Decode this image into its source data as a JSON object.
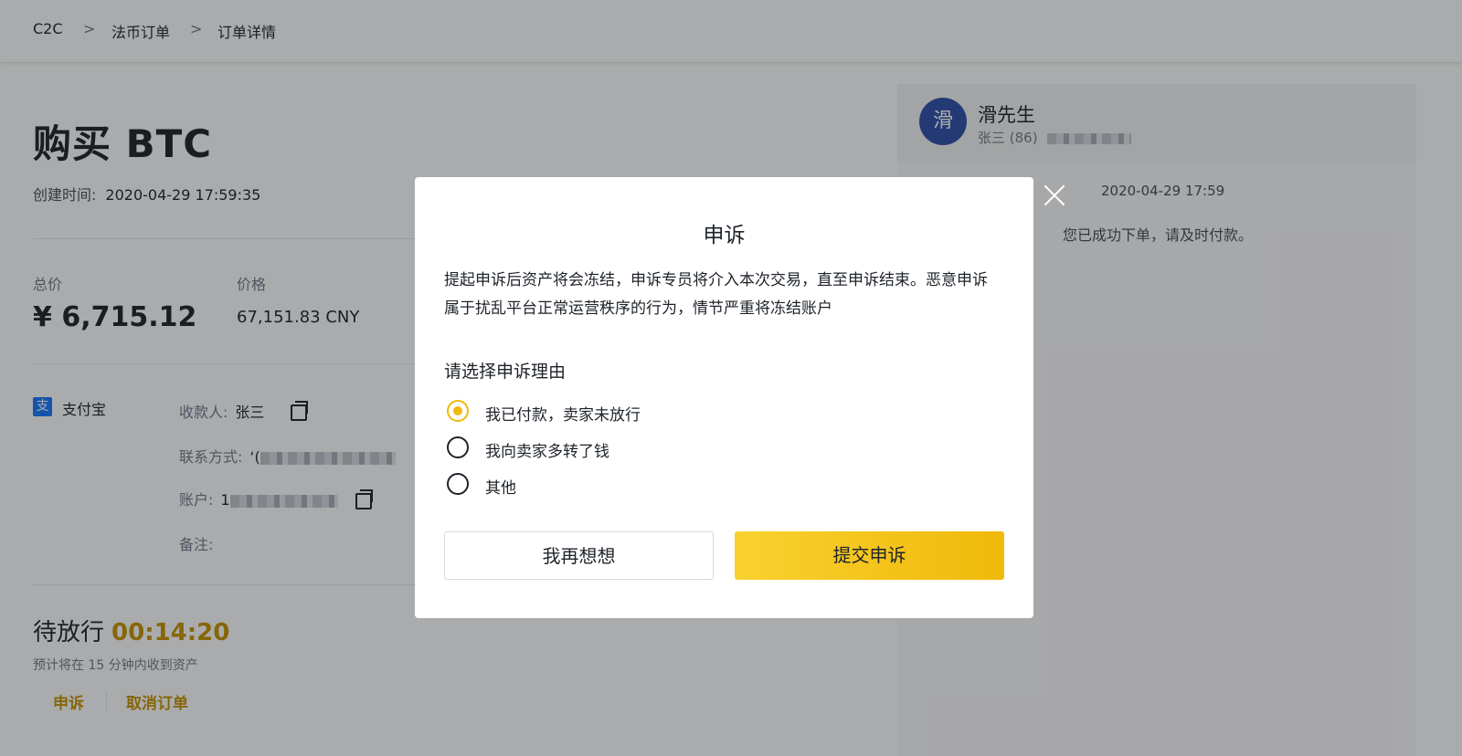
{
  "breadcrumb": {
    "items": [
      "C2C",
      "法币订单",
      "订单详情"
    ],
    "separator": ">"
  },
  "order": {
    "title": "购买 BTC",
    "created_label": "创建时间:",
    "created_value": "2020-04-29 17:59:35",
    "total_label": "总价",
    "total_value": "¥ 6,715.12",
    "price_label": "价格",
    "price_value": "67,151.83 CNY",
    "payment": {
      "method": "支付宝",
      "payee_label": "收款人:",
      "payee_value": "张三",
      "contact_label": "联系方式:",
      "contact_value": "‘(",
      "account_label": "账户:",
      "account_value": "1",
      "note_label": "备注:"
    },
    "status_label": "待放行",
    "timer": "00:14:20",
    "eta": "预计将在 15 分钟内收到资产",
    "appeal_link": "申诉",
    "cancel_link": "取消订单"
  },
  "chat": {
    "avatar_char": "滑",
    "nickname": "滑先生",
    "sub": "张三 (86)",
    "message_time": "2020-04-29 17:59",
    "message": "您已成功下单，请及时付款。"
  },
  "modal": {
    "title": "申诉",
    "description": "提起申诉后资产将会冻结，申诉专员将介入本次交易，直至申诉结束。恶意申诉属于扰乱平台正常运营秩序的行为，情节严重将冻结账户",
    "question": "请选择申诉理由",
    "reasons": [
      {
        "label": "我已付款，卖家未放行",
        "selected": true
      },
      {
        "label": "我向卖家多转了钱",
        "selected": false
      },
      {
        "label": "其他",
        "selected": false
      }
    ],
    "cancel_button": "我再想想",
    "submit_button": "提交申诉"
  },
  "colors": {
    "accent": "#f0b90b",
    "link": "#c99400",
    "avatar": "#2e4fa8"
  }
}
